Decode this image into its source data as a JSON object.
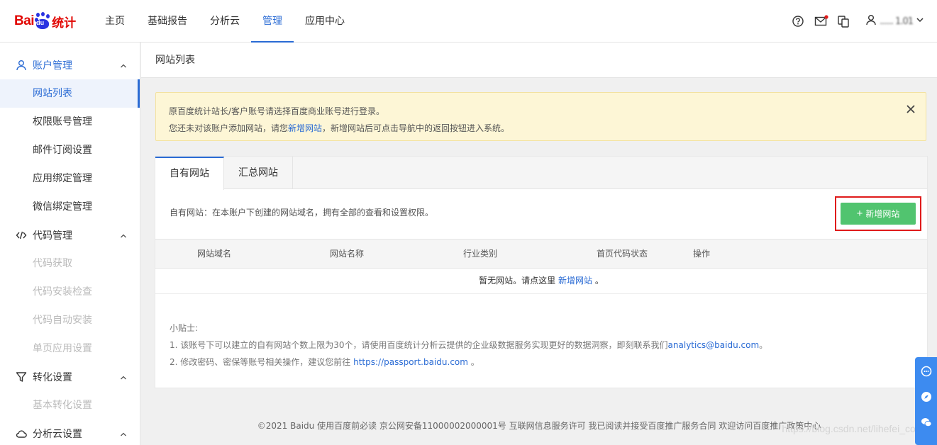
{
  "logo": {
    "part1": "Bai",
    "part2": "du",
    "part3": "统计"
  },
  "nav": {
    "items": [
      {
        "label": "主页"
      },
      {
        "label": "基础报告"
      },
      {
        "label": "分析云"
      },
      {
        "label": "管理"
      },
      {
        "label": "应用中心"
      }
    ]
  },
  "user": {
    "name": "...... 1.01"
  },
  "sidebar": {
    "account_group": "账户管理",
    "account_items": [
      "网站列表",
      "权限账号管理",
      "邮件订阅设置",
      "应用绑定管理",
      "微信绑定管理"
    ],
    "code_group": "代码管理",
    "code_items": [
      "代码获取",
      "代码安装检查",
      "代码自动安装",
      "单页应用设置"
    ],
    "conversion_group": "转化设置",
    "conversion_items": [
      "基本转化设置"
    ],
    "analytics_group": "分析云设置"
  },
  "page": {
    "title": "网站列表"
  },
  "alert": {
    "line1": "原百度统计站长/客户账号请选择百度商业账号进行登录。",
    "line2_pre": "您还未对该账户添加网站，请您",
    "line2_link": "新增网站",
    "line2_post": "，新增网站后可点击导航中的返回按钮进入系统。"
  },
  "tabs": [
    "自有网站",
    "汇总网站"
  ],
  "card": {
    "description": "自有网站：在本账户下创建的网站域名，拥有全部的查看和设置权限。",
    "add_button": "新增网站",
    "columns": [
      "网站域名",
      "网站名称",
      "行业类别",
      "首页代码状态",
      "操作"
    ],
    "empty_pre": "暂无网站。请点这里",
    "empty_link": "新增网站",
    "empty_post": "。"
  },
  "tips": {
    "title": "小贴士:",
    "line1_pre": "1. 该账号下可以建立的自有网站个数上限为30个，请使用百度统计分析云提供的企业级数据服务实现更好的数据洞察，即刻联系我们",
    "line1_link": "analytics@baidu.com",
    "line1_post": "。",
    "line2_pre": "2. 修改密码、密保等账号相关操作，建议您前往",
    "line2_link": "https://passport.baidu.com",
    "line2_post": "。"
  },
  "footer": {
    "text": "©2021 Baidu 使用百度前必读 京公网安备11000002000001号 互联网信息服务许可 我已阅读并接受百度推广服务合同 欢迎访问百度推广政策中心"
  },
  "watermark": "https://blog.csdn.net/lihefei_coder",
  "colors": {
    "accent": "#2a6bd4",
    "add_button": "#51c46f",
    "highlight": "#e01b1b",
    "alert_bg": "#fdf6d6"
  }
}
